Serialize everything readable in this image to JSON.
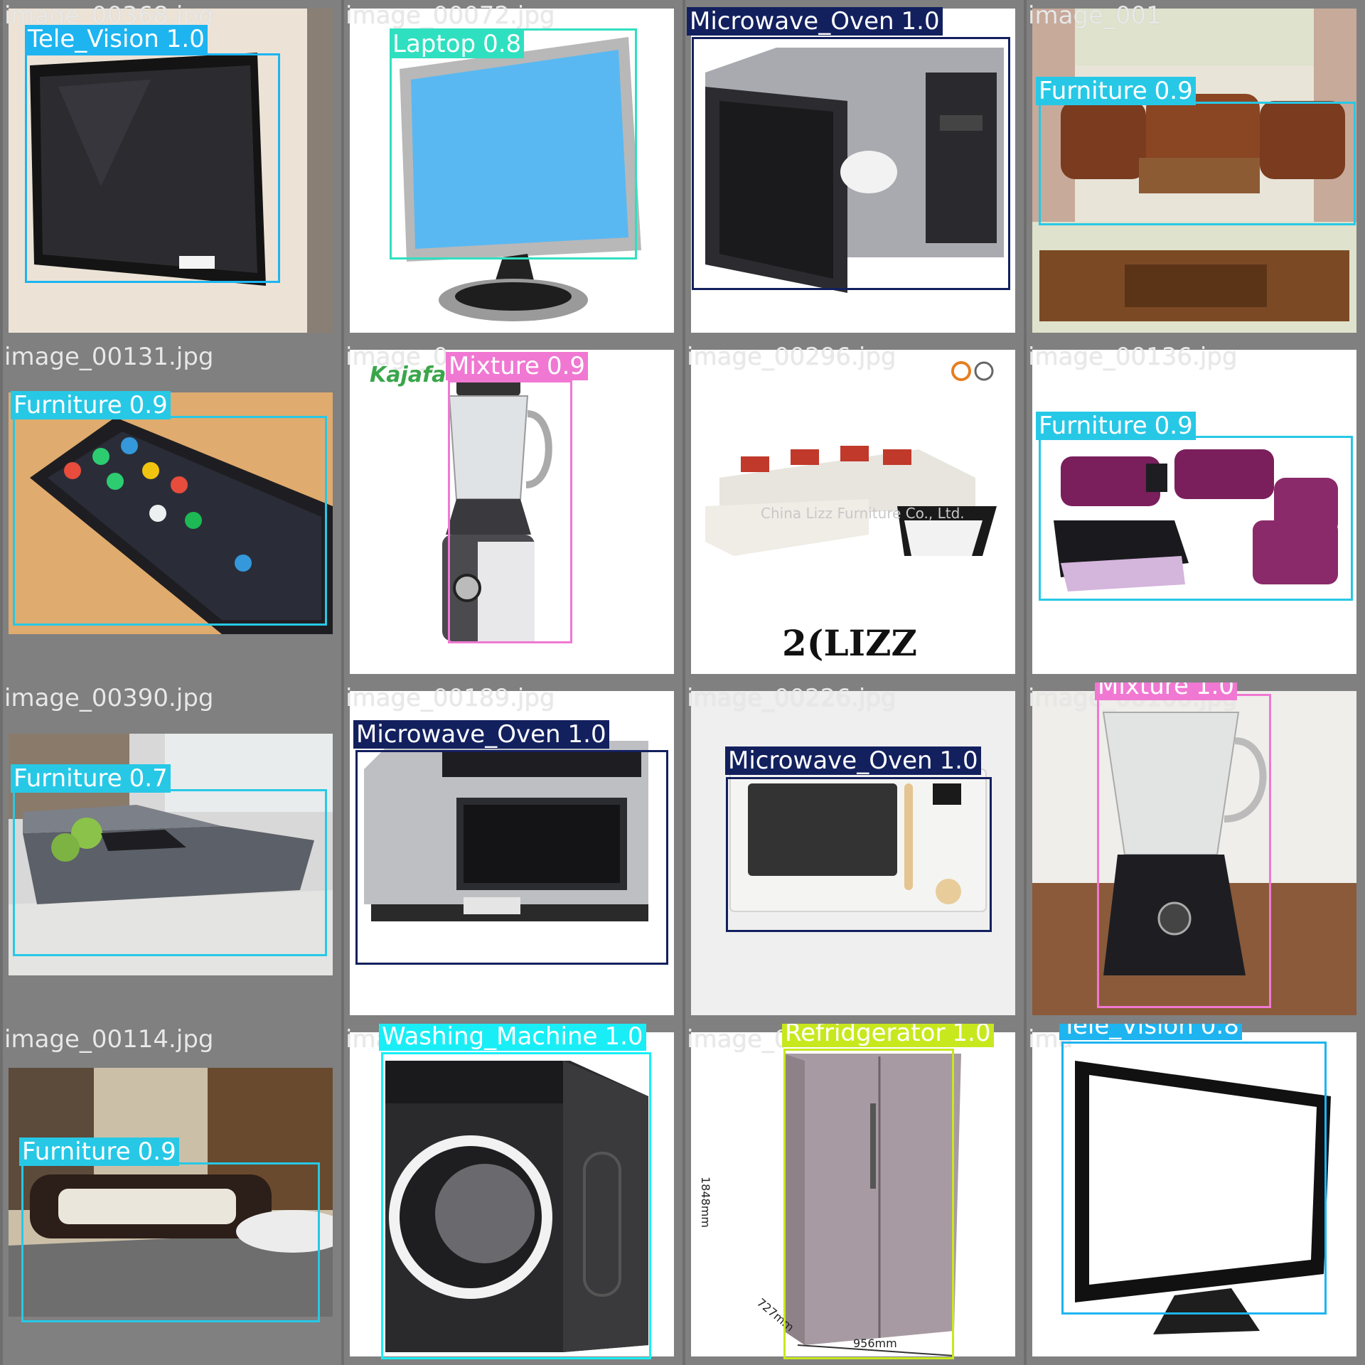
{
  "colors": {
    "tele_vision": "#1eb4f0",
    "laptop": "#2fe0c0",
    "microwave_oven": "#13205e",
    "furniture": "#27c8e6",
    "mixture": "#f078d2",
    "washing_machine": "#19eef6",
    "refridgerator": "#c8e81e"
  },
  "tiles": [
    {
      "file": "image_00368.jpg",
      "label": "Tele_Vision",
      "conf": "1.0",
      "color_key": "tele_vision",
      "icon": "tv"
    },
    {
      "file": "image_00072.jpg",
      "label": "Laptop",
      "conf": "0.8",
      "color_key": "laptop",
      "icon": "monitor"
    },
    {
      "file": "",
      "label": "Microwave_Oven",
      "conf": "1.0",
      "color_key": "microwave_oven",
      "icon": "microwave"
    },
    {
      "file": "image_001",
      "label": "Furniture",
      "conf": "0.9",
      "color_key": "furniture",
      "icon": "sofa"
    },
    {
      "file": "image_00131.jpg",
      "label": "Furniture",
      "conf": "0.9",
      "color_key": "furniture",
      "icon": "phone"
    },
    {
      "file": "image_0",
      "label": "Mixture",
      "conf": "0.9",
      "color_key": "mixture",
      "icon": "blender",
      "logo": "Kajafa"
    },
    {
      "file": "image_00296.jpg",
      "label": "",
      "conf": "",
      "color_key": "furniture",
      "icon": "sofa-white",
      "logo": "2(LIZZ",
      "watermark": "China Lizz Furniture Co., Ltd."
    },
    {
      "file": "image_00136.jpg",
      "label": "Furniture",
      "conf": "0.9",
      "color_key": "furniture",
      "icon": "sofa-purple"
    },
    {
      "file": "image_00390.jpg",
      "label": "Furniture",
      "conf": "0.7",
      "color_key": "furniture",
      "icon": "sofa-grey"
    },
    {
      "file": "image_00189.jpg",
      "label": "Microwave_Oven",
      "conf": "1.0",
      "color_key": "microwave_oven",
      "icon": "microwave-steel"
    },
    {
      "file": "image_00226.jpg",
      "label": "Microwave_Oven",
      "conf": "1.0",
      "color_key": "microwave_oven",
      "icon": "microwave-white"
    },
    {
      "file": "image_00100.jpg",
      "label": "Mixture",
      "conf": "1.0",
      "color_key": "mixture",
      "icon": "blender-photo"
    },
    {
      "file": "image_00114.jpg",
      "label": "Furniture",
      "conf": "0.9",
      "color_key": "furniture",
      "icon": "sofa-room"
    },
    {
      "file": "ima",
      "label": "Washing_Machine",
      "conf": "1.0",
      "color_key": "washing_machine",
      "icon": "washer"
    },
    {
      "file": "image_0",
      "label": "Refridgerator",
      "conf": "1.0",
      "color_key": "refridgerator",
      "icon": "fridge",
      "dims": [
        "1848mm",
        "956mm",
        "727mm"
      ]
    },
    {
      "file": "ima",
      "label": "Tele_Vision",
      "conf": "0.8",
      "color_key": "tele_vision",
      "icon": "tv-frame"
    }
  ]
}
